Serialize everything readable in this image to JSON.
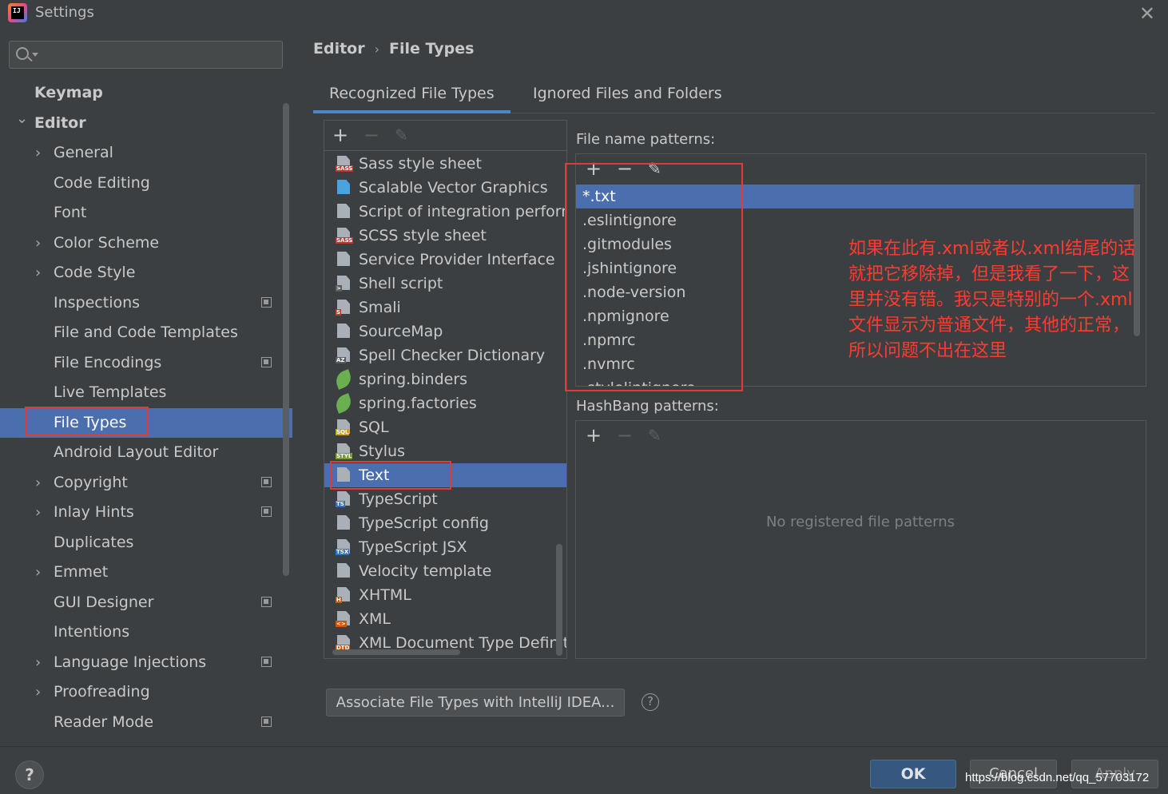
{
  "window": {
    "title": "Settings"
  },
  "sidebar": {
    "search_placeholder": "",
    "items": [
      {
        "label": "Keymap",
        "level": 0,
        "expandable": false,
        "expanded": false,
        "project_icon": false,
        "selected": false
      },
      {
        "label": "Editor",
        "level": 0,
        "expandable": true,
        "expanded": true,
        "project_icon": false,
        "selected": false
      },
      {
        "label": "General",
        "level": 1,
        "expandable": true,
        "expanded": false,
        "project_icon": false,
        "selected": false
      },
      {
        "label": "Code Editing",
        "level": 1,
        "expandable": false,
        "expanded": false,
        "project_icon": false,
        "selected": false
      },
      {
        "label": "Font",
        "level": 1,
        "expandable": false,
        "expanded": false,
        "project_icon": false,
        "selected": false
      },
      {
        "label": "Color Scheme",
        "level": 1,
        "expandable": true,
        "expanded": false,
        "project_icon": false,
        "selected": false
      },
      {
        "label": "Code Style",
        "level": 1,
        "expandable": true,
        "expanded": false,
        "project_icon": false,
        "selected": false
      },
      {
        "label": "Inspections",
        "level": 1,
        "expandable": false,
        "expanded": false,
        "project_icon": true,
        "selected": false
      },
      {
        "label": "File and Code Templates",
        "level": 1,
        "expandable": false,
        "expanded": false,
        "project_icon": false,
        "selected": false
      },
      {
        "label": "File Encodings",
        "level": 1,
        "expandable": false,
        "expanded": false,
        "project_icon": true,
        "selected": false
      },
      {
        "label": "Live Templates",
        "level": 1,
        "expandable": false,
        "expanded": false,
        "project_icon": false,
        "selected": false
      },
      {
        "label": "File Types",
        "level": 1,
        "expandable": false,
        "expanded": false,
        "project_icon": false,
        "selected": true
      },
      {
        "label": "Android Layout Editor",
        "level": 1,
        "expandable": false,
        "expanded": false,
        "project_icon": false,
        "selected": false
      },
      {
        "label": "Copyright",
        "level": 1,
        "expandable": true,
        "expanded": false,
        "project_icon": true,
        "selected": false
      },
      {
        "label": "Inlay Hints",
        "level": 1,
        "expandable": true,
        "expanded": false,
        "project_icon": true,
        "selected": false
      },
      {
        "label": "Duplicates",
        "level": 1,
        "expandable": false,
        "expanded": false,
        "project_icon": false,
        "selected": false
      },
      {
        "label": "Emmet",
        "level": 1,
        "expandable": true,
        "expanded": false,
        "project_icon": false,
        "selected": false
      },
      {
        "label": "GUI Designer",
        "level": 1,
        "expandable": false,
        "expanded": false,
        "project_icon": true,
        "selected": false
      },
      {
        "label": "Intentions",
        "level": 1,
        "expandable": false,
        "expanded": false,
        "project_icon": false,
        "selected": false
      },
      {
        "label": "Language Injections",
        "level": 1,
        "expandable": true,
        "expanded": false,
        "project_icon": true,
        "selected": false
      },
      {
        "label": "Proofreading",
        "level": 1,
        "expandable": true,
        "expanded": false,
        "project_icon": false,
        "selected": false
      },
      {
        "label": "Reader Mode",
        "level": 1,
        "expandable": false,
        "expanded": false,
        "project_icon": true,
        "selected": false
      }
    ]
  },
  "breadcrumb": {
    "parent": "Editor",
    "current": "File Types",
    "separator": "›"
  },
  "tabs": [
    {
      "label": "Recognized File Types",
      "active": true
    },
    {
      "label": "Ignored Files and Folders",
      "active": false
    }
  ],
  "file_types": {
    "toolbar": {
      "add": "+",
      "remove": "−",
      "edit": "✎"
    },
    "items": [
      {
        "name": "Sass style sheet",
        "icon": "sass-icon",
        "tag": "SASS",
        "tag_color": "#c0392b"
      },
      {
        "name": "Scalable Vector Graphics",
        "icon": "svg-icon",
        "tag": "",
        "tag_color": "#4aa3df"
      },
      {
        "name": "Script of integration performa",
        "icon": "script-icon",
        "tag": "",
        "tag_color": ""
      },
      {
        "name": "SCSS style sheet",
        "icon": "scss-icon",
        "tag": "SASS",
        "tag_color": "#c0392b"
      },
      {
        "name": "Service Provider Interface",
        "icon": "spi-icon",
        "tag": "",
        "tag_color": ""
      },
      {
        "name": "Shell script",
        "icon": "shell-icon",
        "tag": ">",
        "tag_color": "#5a5d5f"
      },
      {
        "name": "Smali",
        "icon": "smali-icon",
        "tag": "S",
        "tag_color": "#c0392b"
      },
      {
        "name": "SourceMap",
        "icon": "sourcemap-icon",
        "tag": "",
        "tag_color": ""
      },
      {
        "name": "Spell Checker Dictionary",
        "icon": "dictionary-icon",
        "tag": "AZ",
        "tag_color": "#5a5d5f"
      },
      {
        "name": "spring.binders",
        "icon": "spring-icon",
        "tag": "",
        "tag_color": ""
      },
      {
        "name": "spring.factories",
        "icon": "spring-icon",
        "tag": "",
        "tag_color": ""
      },
      {
        "name": "SQL",
        "icon": "sql-icon",
        "tag": "SQL",
        "tag_color": "#d4a017"
      },
      {
        "name": "Stylus",
        "icon": "stylus-icon",
        "tag": "STYL",
        "tag_color": "#7a9a3a"
      },
      {
        "name": "Text",
        "icon": "text-icon",
        "tag": "",
        "tag_color": ""
      },
      {
        "name": "TypeScript",
        "icon": "typescript-icon",
        "tag": "TS",
        "tag_color": "#2f74c0"
      },
      {
        "name": "TypeScript config",
        "icon": "tsconfig-icon",
        "tag": "",
        "tag_color": ""
      },
      {
        "name": "TypeScript JSX",
        "icon": "tsx-icon",
        "tag": "TSX",
        "tag_color": "#2f74c0"
      },
      {
        "name": "Velocity template",
        "icon": "velocity-icon",
        "tag": "",
        "tag_color": ""
      },
      {
        "name": "XHTML",
        "icon": "xhtml-icon",
        "tag": "H",
        "tag_color": "#d35400"
      },
      {
        "name": "XML",
        "icon": "xml-icon",
        "tag": "<>",
        "tag_color": "#d35400"
      },
      {
        "name": "XML Document Type Definitio",
        "icon": "dtd-icon",
        "tag": "DTD",
        "tag_color": "#d35400"
      }
    ],
    "selected": "Text"
  },
  "file_name_patterns": {
    "title": "File name patterns:",
    "items": [
      "*.txt",
      ".eslintignore",
      ".gitmodules",
      ".jshintignore",
      ".node-version",
      ".npmignore",
      ".npmrc",
      ".nvmrc",
      ".stylelintignore"
    ],
    "selected": "*.txt"
  },
  "hashbang_patterns": {
    "title": "HashBang patterns:",
    "empty_message": "No registered file patterns"
  },
  "annotation": {
    "lines": [
      "如果在此有.xml或者以.xml结尾的话",
      "就把它移除掉，但是我看了一下，这",
      "里并没有错。我只是特别的一个.xml",
      "文件显示为普通文件，其他的正常，",
      "所以问题不出在这里"
    ],
    "color": "#ff3b30"
  },
  "associate_button": {
    "label": "Associate File Types with IntelliJ IDEA..."
  },
  "footer": {
    "ok": "OK",
    "cancel": "Cancel",
    "apply": "Apply",
    "help": "?",
    "watermark": "https://blog.csdn.net/qq_57703172"
  },
  "colors": {
    "background": "#3c3f41",
    "selection": "#4b6eaf",
    "accent_tab": "#4a88c7",
    "annotation_box": "#e53935"
  }
}
